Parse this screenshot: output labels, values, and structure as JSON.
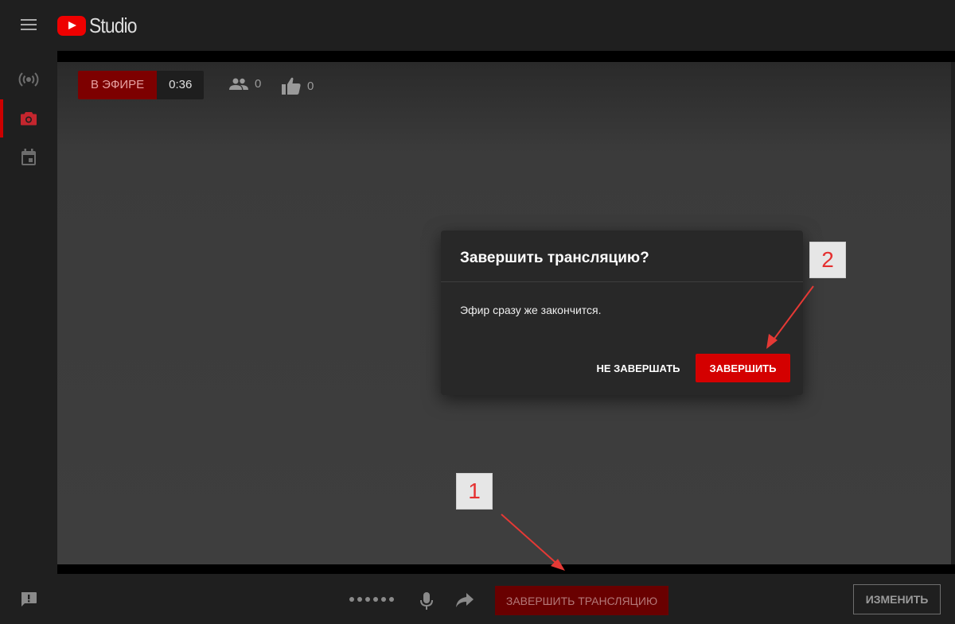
{
  "header": {
    "logo_text": "Studio"
  },
  "sidebar": {
    "items": [
      {
        "name": "live-broadcast",
        "icon": "broadcast-icon",
        "active": false
      },
      {
        "name": "webcam",
        "icon": "camera-icon",
        "active": true
      },
      {
        "name": "managed",
        "icon": "calendar-icon",
        "active": false
      }
    ],
    "feedback_icon": "feedback-icon"
  },
  "stream": {
    "live_label": "В ЭФИРЕ",
    "elapsed": "0:36",
    "viewers": "0",
    "likes": "0"
  },
  "bottombar": {
    "end_stream_label": "ЗАВЕРШИТЬ ТРАНСЛЯЦИЮ",
    "edit_label": "ИЗМЕНИТЬ"
  },
  "dialog": {
    "title": "Завершить трансляцию?",
    "body": "Эфир сразу же закончится.",
    "cancel_label": "НЕ ЗАВЕРШАТЬ",
    "confirm_label": "ЗАВЕРШИТЬ"
  },
  "annotations": {
    "marker_1": "1",
    "marker_2": "2"
  },
  "colors": {
    "accent_red": "#d40000",
    "arrow_red": "#e53935",
    "background": "#1f1f1f",
    "stage": "#3e3e3e"
  }
}
